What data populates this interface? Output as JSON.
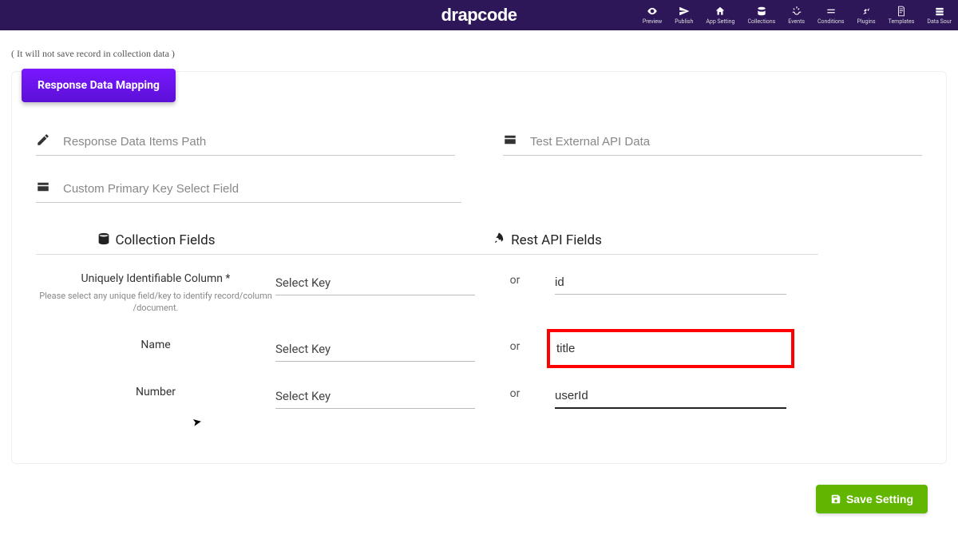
{
  "brand": "drapcode",
  "nav": [
    {
      "label": "Preview"
    },
    {
      "label": "Publish"
    },
    {
      "label": "App Setting"
    },
    {
      "label": "Collections"
    },
    {
      "label": "Events"
    },
    {
      "label": "Conditions"
    },
    {
      "label": "Plugins"
    },
    {
      "label": "Templates"
    },
    {
      "label": "Data Sour"
    },
    {
      "label": ""
    }
  ],
  "hint": "( It will not save record in collection data )",
  "tab": "Response Data Mapping",
  "fields": {
    "items_path_placeholder": "Response Data Items Path",
    "test_api_placeholder": "Test External API Data",
    "primary_key_placeholder": "Custom Primary Key Select Field"
  },
  "headings": {
    "collection": "Collection Fields",
    "api": "Rest API Fields"
  },
  "rows": [
    {
      "label": "Uniquely Identifiable Column *",
      "sublabel": "Please select any unique field/key to identify record/column /document.",
      "select": "Select Key",
      "or": "or",
      "value": "id"
    },
    {
      "label": "Name",
      "select": "Select Key",
      "or": "or",
      "value": "title"
    },
    {
      "label": "Number",
      "select": "Select Key",
      "or": "or",
      "value": "userId"
    }
  ],
  "save": "Save Setting"
}
